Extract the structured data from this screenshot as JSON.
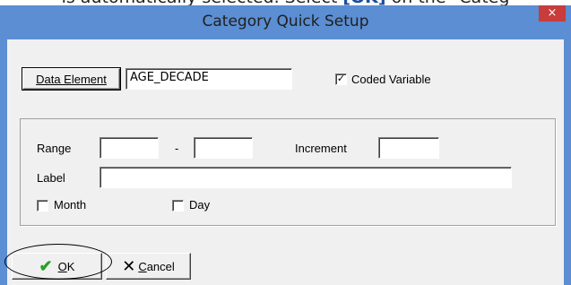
{
  "instruction": {
    "text_before": "is automatically selected. Select ",
    "strong": "[OK]",
    "text_after": " on the \"Categ"
  },
  "dialog": {
    "title": "Category Quick Setup",
    "close_glyph": "×",
    "data_element_button": {
      "prefix": "D",
      "rest": "ata Element"
    },
    "data_element_value": "AGE_DECADE",
    "coded_variable": {
      "label": "Coded Variable",
      "checked": true,
      "glyph": "✓"
    },
    "range": {
      "label": "Range",
      "from": "",
      "dash": "-",
      "to": ""
    },
    "increment": {
      "label": "Increment",
      "value": ""
    },
    "label_field": {
      "label": "Label",
      "value": ""
    },
    "month": {
      "label": "Month",
      "checked": false
    },
    "day": {
      "label": "Day",
      "checked": false
    },
    "ok_button": {
      "icon": "check-icon",
      "mnemonic": "O",
      "rest": "K"
    },
    "cancel_button": {
      "icon": "x-icon",
      "mnemonic": "C",
      "rest": "ancel"
    }
  }
}
